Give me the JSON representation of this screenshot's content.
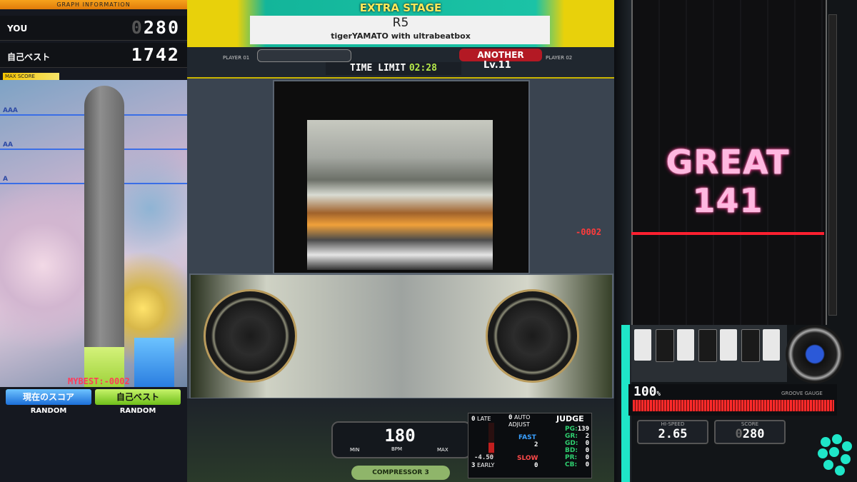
{
  "graph": {
    "header": "GRAPH INFORMATION",
    "you_label": "YOU",
    "you_score_dim": "0",
    "you_score": "280",
    "best_label": "自己ベスト",
    "best_score": "1742",
    "max_score_label": "MAX SCORE",
    "lines": [
      "AAA",
      "AA",
      "A"
    ],
    "you_fill": 0.13,
    "best_fill": 0.16,
    "mybest_diff": "MYBEST:-0002",
    "buttons": {
      "current": "現在のスコア",
      "best": "自己ベスト"
    },
    "option_left": "RANDOM",
    "option_right": "RANDOM"
  },
  "stage": {
    "title": "EXTRA STAGE",
    "song": "R5",
    "artist": "tigerYAMATO with ultrabeatbox",
    "player1": "PLAYER 01",
    "player2": "PLAYER 02",
    "difficulty": "ANOTHER",
    "level": "Lv.11",
    "time_limit_label": "TIME LIMIT",
    "time_limit": "02:28"
  },
  "hud": {
    "bpm": "180",
    "bpm_label": "BPM",
    "min_label": "MIN",
    "max_label": "MAX",
    "effect": "COMPRESSOR 3",
    "late_count": "0",
    "late_label": "LATE",
    "auto_adjust_count": "0",
    "auto_adjust_label": "AUTO ADJUST",
    "early_count": "3",
    "early_label": "EARLY",
    "offset": "-4.50",
    "fast_label": "FAST",
    "fast": "2",
    "slow_label": "SLOW",
    "slow": "0",
    "judge_title": "JUDGE",
    "judges": [
      {
        "label": "PG:",
        "value": "139"
      },
      {
        "label": "GR:",
        "value": "2"
      },
      {
        "label": "GD:",
        "value": "0"
      },
      {
        "label": "BD:",
        "value": "0"
      },
      {
        "label": "PR:",
        "value": "0"
      },
      {
        "label": "CB:",
        "value": "0"
      }
    ]
  },
  "play": {
    "judgement": "GREAT",
    "combo": "141",
    "timing_diff": "-0002",
    "gauge_value": "100",
    "gauge_unit": "%",
    "gauge_label": "GROOVE GAUGE",
    "hispeed_label": "HI-SPEED",
    "hispeed": "2.65",
    "score_label": "SCORE",
    "score_dim": "0",
    "score": "280"
  },
  "colors": {
    "accent": "#1bc3a6",
    "great": "#ff2c8e",
    "gauge": "#ff2a2a"
  }
}
